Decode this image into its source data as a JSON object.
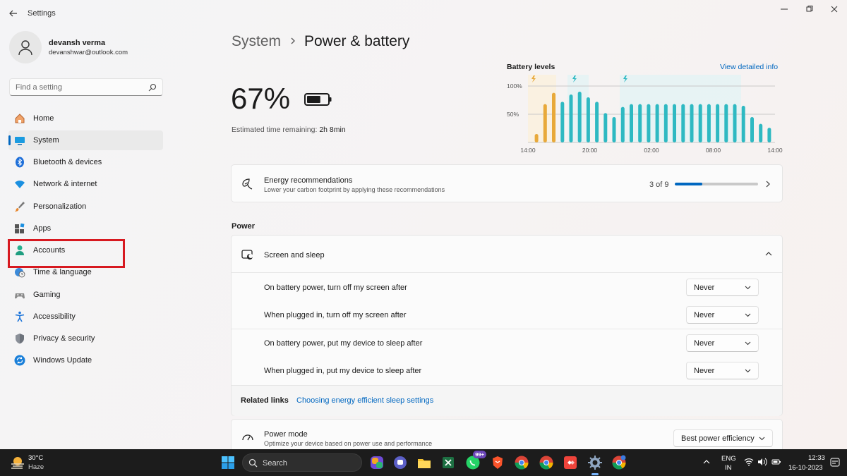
{
  "window": {
    "title": "Settings"
  },
  "profile": {
    "name": "devansh verma",
    "email": "devanshwar@outlook.com"
  },
  "search": {
    "placeholder": "Find a setting"
  },
  "nav": {
    "items": [
      {
        "label": "Home",
        "icon": "home-icon"
      },
      {
        "label": "System",
        "icon": "system-icon",
        "active": true
      },
      {
        "label": "Bluetooth & devices",
        "icon": "bluetooth-icon"
      },
      {
        "label": "Network & internet",
        "icon": "wifi-icon"
      },
      {
        "label": "Personalization",
        "icon": "brush-icon"
      },
      {
        "label": "Apps",
        "icon": "apps-icon"
      },
      {
        "label": "Accounts",
        "icon": "accounts-icon",
        "highlighted": true
      },
      {
        "label": "Time & language",
        "icon": "time-language-icon"
      },
      {
        "label": "Gaming",
        "icon": "gaming-icon"
      },
      {
        "label": "Accessibility",
        "icon": "accessibility-icon"
      },
      {
        "label": "Privacy & security",
        "icon": "shield-icon"
      },
      {
        "label": "Windows Update",
        "icon": "update-icon"
      }
    ]
  },
  "breadcrumb": {
    "parent": "System",
    "current": "Power & battery"
  },
  "battery": {
    "percent": "67%",
    "level": 0.67,
    "remaining_label": "Estimated time remaining:",
    "remaining_value": "2h 8min"
  },
  "chart_data": {
    "type": "bar",
    "title": "Battery levels",
    "link_label": "View detailed info",
    "y_ticks": [
      "100%",
      "50%"
    ],
    "x_ticks": [
      "14:00",
      "20:00",
      "02:00",
      "08:00",
      "14:00"
    ],
    "ylim": [
      0,
      100
    ],
    "grid": true,
    "values": [
      15,
      68,
      88,
      72,
      85,
      90,
      80,
      72,
      52,
      45,
      63,
      68,
      68,
      68,
      68,
      68,
      68,
      68,
      68,
      68,
      68,
      68,
      68,
      68,
      65,
      45,
      33,
      26
    ],
    "colors": {
      "charging_low": "#e8a93a",
      "normal": "#2eb9c2"
    },
    "orange_bar_count": 3
  },
  "energy": {
    "title": "Energy recommendations",
    "subtitle": "Lower your carbon footprint by applying these recommendations",
    "count": "3 of 9",
    "progress": 0.333
  },
  "power": {
    "section_label": "Power",
    "screen_sleep": {
      "title": "Screen and sleep",
      "rows": [
        {
          "label": "On battery power, turn off my screen after",
          "value": "Never"
        },
        {
          "label": "When plugged in, turn off my screen after",
          "value": "Never"
        },
        {
          "label": "On battery power, put my device to sleep after",
          "value": "Never"
        },
        {
          "label": "When plugged in, put my device to sleep after",
          "value": "Never"
        }
      ],
      "related_label": "Related links",
      "related_link": "Choosing energy efficient sleep settings"
    },
    "power_mode": {
      "title": "Power mode",
      "subtitle": "Optimize your device based on power use and performance",
      "value": "Best power efficiency"
    }
  },
  "taskbar": {
    "weather_temp": "30°C",
    "weather_desc": "Haze",
    "search_label": "Search",
    "whatsapp_badge": "99+",
    "language_line1": "ENG",
    "language_line2": "IN",
    "time": "12:33",
    "date": "16-10-2023"
  },
  "colors": {
    "accent": "#0067c0",
    "highlight_box": "#d71920",
    "teal": "#2eb9c2",
    "orange": "#e8a93a"
  }
}
